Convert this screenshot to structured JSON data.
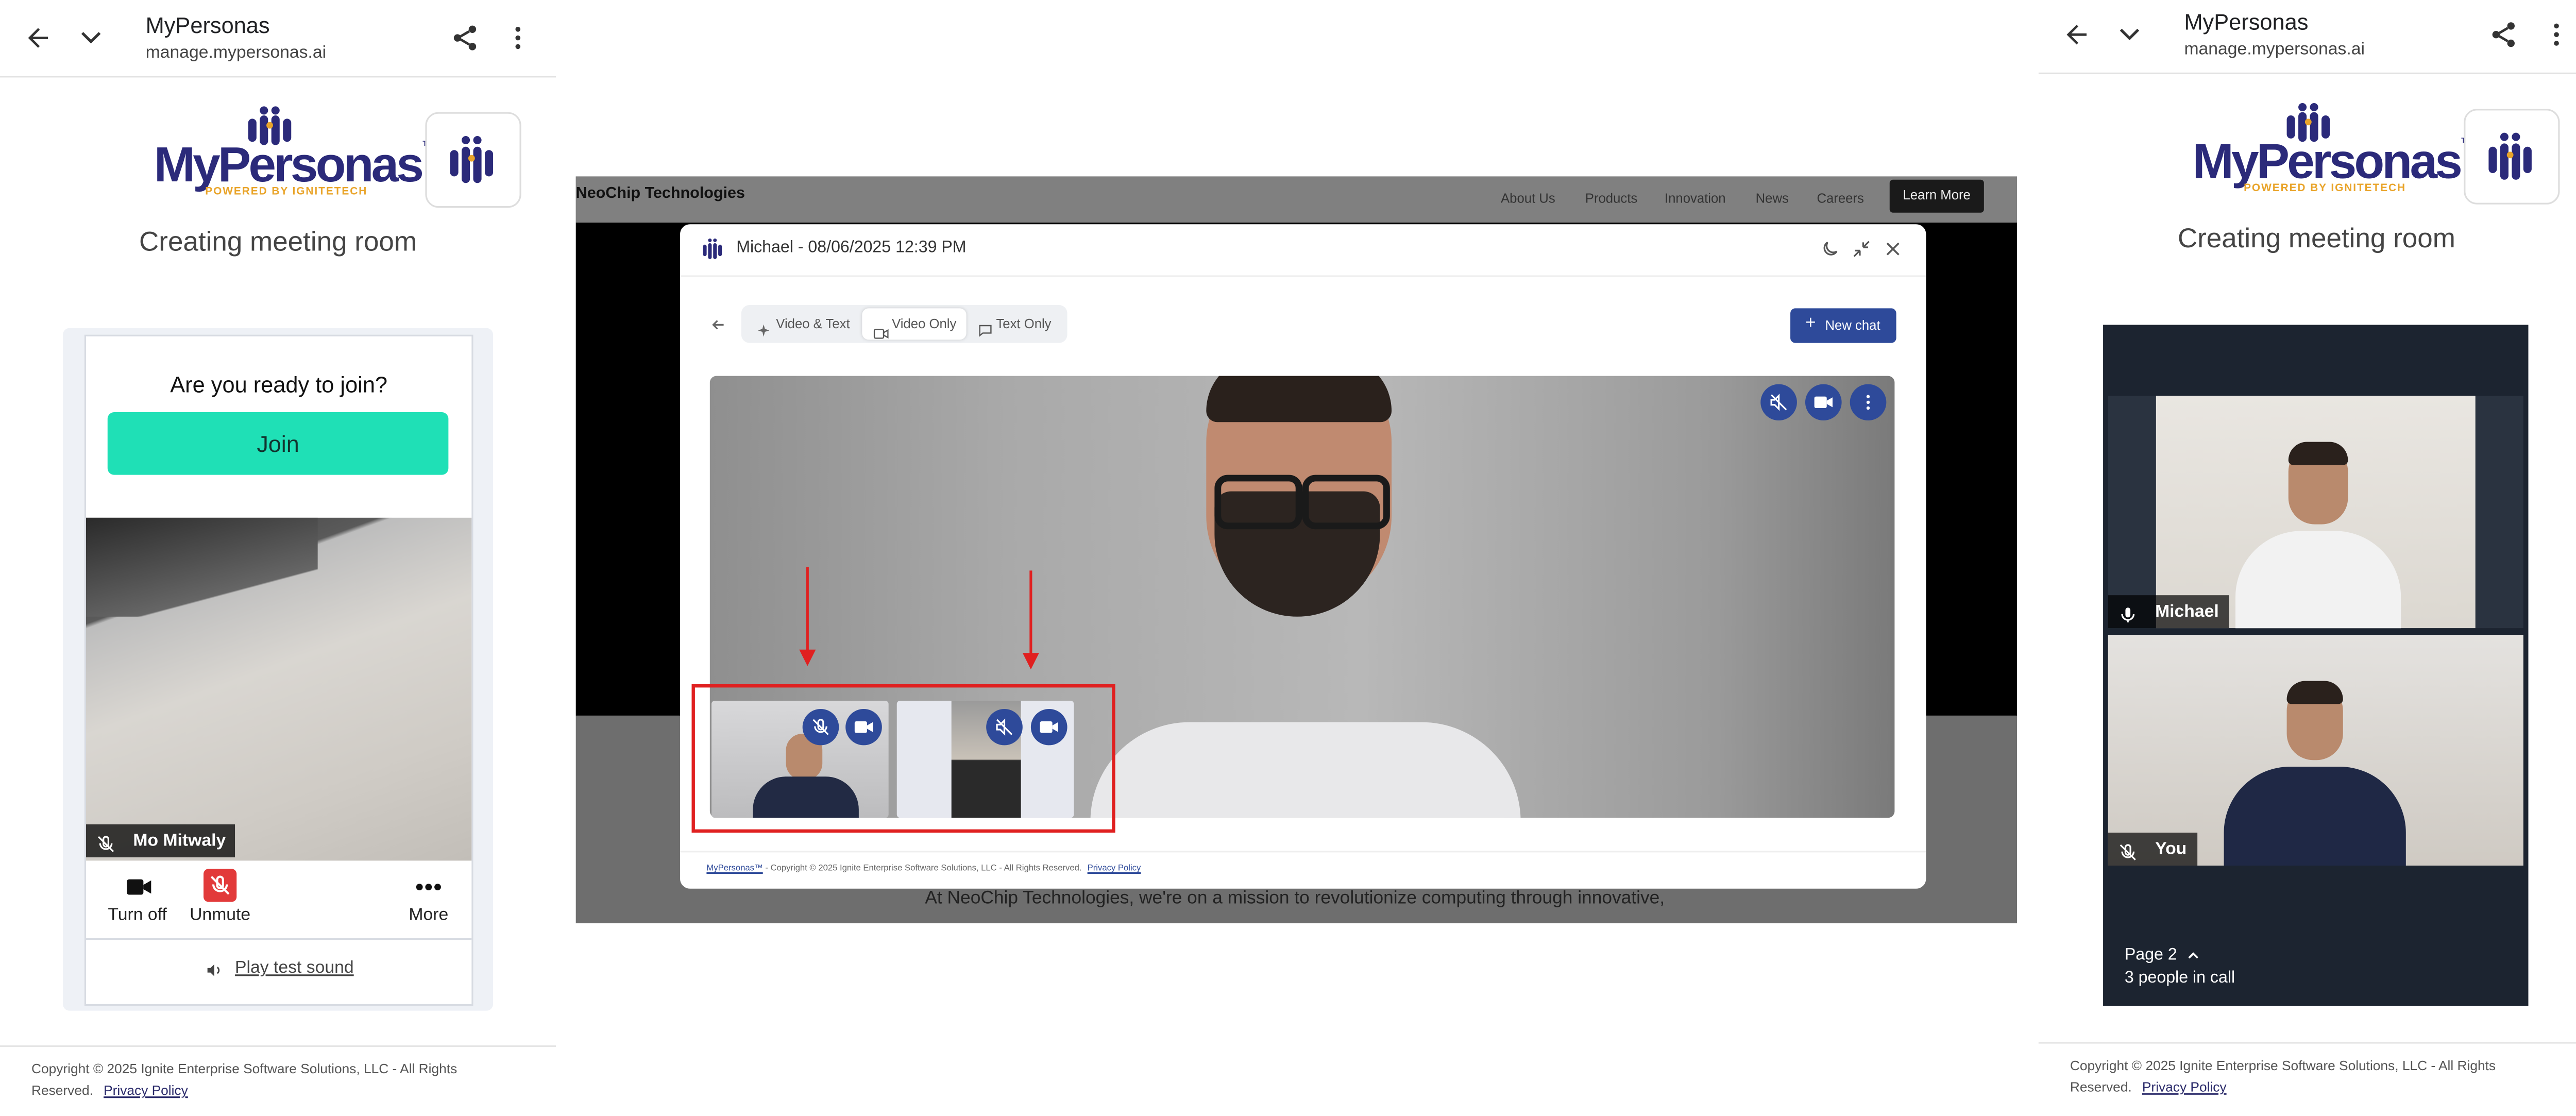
{
  "left_panel": {
    "header": {
      "title": "MyPersonas",
      "url": "manage.mypersonas.ai"
    },
    "logo": {
      "word": "MyPersonas",
      "tm": "™",
      "sub": "POWERED BY IGNITETECH"
    },
    "status": "Creating meeting room",
    "card": {
      "question": "Are you ready to join?",
      "join_label": "Join",
      "participant_name": "Mo Mitwaly",
      "controls": {
        "turn_off": "Turn off",
        "unmute": "Unmute",
        "more": "More"
      },
      "test_sound": "Play test sound"
    },
    "footer": {
      "copyright": "Copyright © 2025 Ignite Enterprise Software Solutions, LLC - All Rights Reserved.",
      "privacy": "Privacy Policy"
    }
  },
  "middle_panel": {
    "site": {
      "brand": "NeoChip Technologies",
      "nav": [
        "About Us",
        "Products",
        "Innovation",
        "News",
        "Careers"
      ],
      "cta": "Learn More",
      "body_text": "At NeoChip Technologies, we're on a mission to revolutionize computing through innovative,"
    },
    "modal": {
      "title": "Michael - 08/06/2025 12:39 PM",
      "tabs": [
        {
          "label": "Video & Text",
          "active": false
        },
        {
          "label": "Video Only",
          "active": true
        },
        {
          "label": "Text Only",
          "active": false
        }
      ],
      "new_chat": "New chat",
      "footer_brand": "MyPersonas™",
      "footer_text": " - Copyright © 2025 Ignite Enterprise Software Solutions, LLC - All Rights Reserved.",
      "footer_privacy": "Privacy Policy"
    },
    "colors": {
      "accent": "#2e4a9a",
      "annotation": "#e02020"
    }
  },
  "right_panel": {
    "header": {
      "title": "MyPersonas",
      "url": "manage.mypersonas.ai"
    },
    "logo": {
      "word": "MyPersonas",
      "tm": "™",
      "sub": "POWERED BY IGNITETECH"
    },
    "status": "Creating meeting room",
    "call": {
      "tiles": [
        {
          "name": "Michael"
        },
        {
          "name": "You"
        }
      ],
      "page": "Page 2",
      "people": "3 people in call"
    },
    "footer": {
      "copyright": "Copyright © 2025 Ignite Enterprise Software Solutions, LLC - All Rights Reserved.",
      "privacy": "Privacy Policy"
    }
  }
}
